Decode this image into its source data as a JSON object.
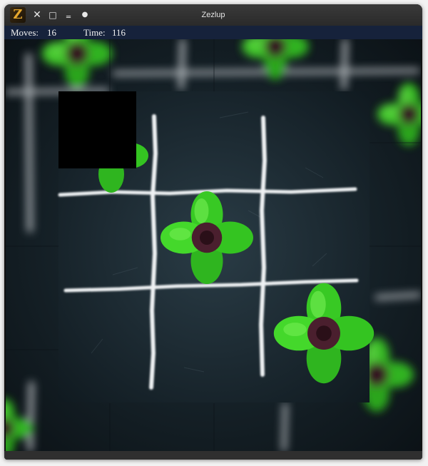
{
  "window": {
    "title": "Zezlup",
    "icon_glyph": "Z",
    "icon_name": "zezlup-app-icon",
    "controls": [
      {
        "name": "close-icon",
        "glyph": "✕"
      },
      {
        "name": "maximize-icon",
        "glyph": "□"
      },
      {
        "name": "minimize-icon",
        "glyph": "‗"
      },
      {
        "name": "sticky-icon",
        "glyph": "●"
      }
    ]
  },
  "status": {
    "moves_label": "Moves:",
    "moves_value": "16",
    "time_label": "Time:",
    "time_value": "116"
  },
  "puzzle": {
    "image_subject": "chalk tic-tac-toe grid on slate with four-leaf clovers",
    "empty_tile_color": "#000000",
    "colors": {
      "slate": "#1b2a33",
      "chalk": "#e8ecef",
      "clover_green": "#3fd52a",
      "clover_center": "#4a1f2e"
    }
  }
}
